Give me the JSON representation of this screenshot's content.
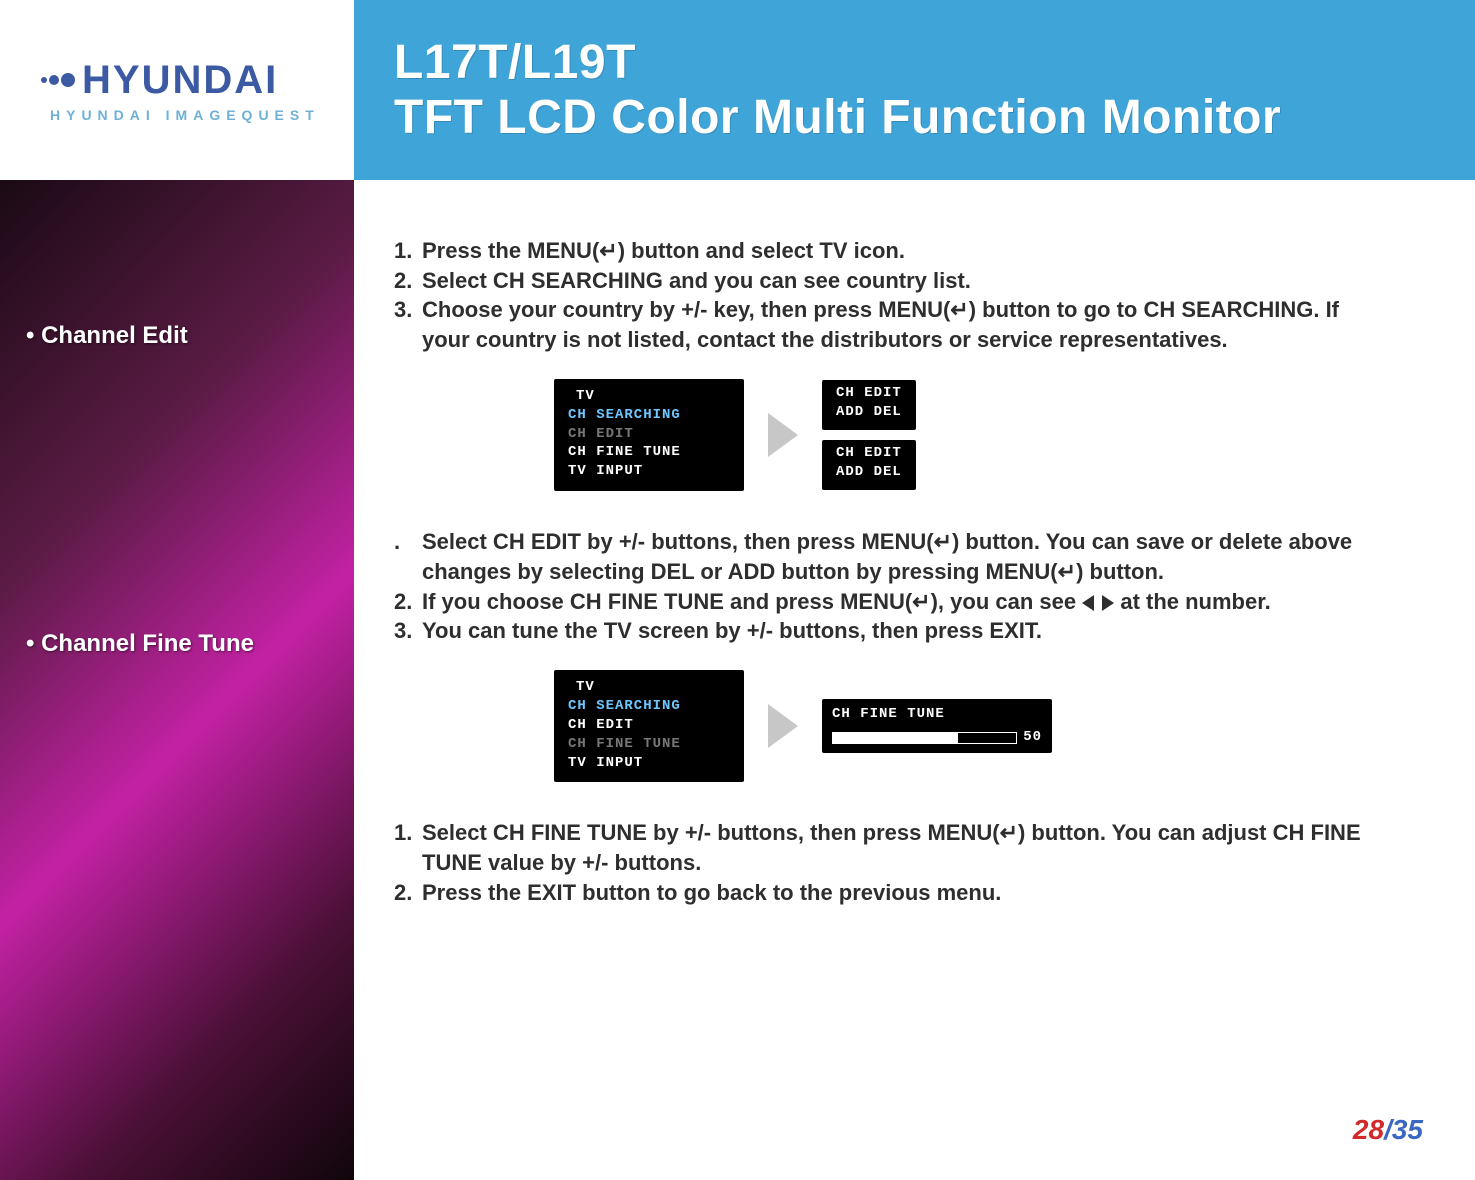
{
  "logo": {
    "brand": "HYUNDAI",
    "subtitle": "HYUNDAI  IMAGEQUEST"
  },
  "title": {
    "line1": "L17T/L19T",
    "line2": "TFT LCD Color Multi Function Monitor"
  },
  "sidebar": {
    "item_edit": "• Channel Edit",
    "item_fine": "• Channel Fine Tune"
  },
  "section1": {
    "steps": [
      {
        "n": "1.",
        "t": "Press the MENU(↵) button and select TV icon."
      },
      {
        "n": "2.",
        "t": "Select CH SEARCHING and you can see country list."
      },
      {
        "n": "3.",
        "t": "Choose your country by +/- key, then press MENU(↵) button to go to CH SEARCHING. If your country is not listed, contact the distributors or service representatives."
      }
    ]
  },
  "osd1": {
    "menu_title": "TV",
    "items": [
      {
        "label": "CH  SEARCHING",
        "state": "hi"
      },
      {
        "label": "CH  EDIT",
        "state": "dim"
      },
      {
        "label": "CH  FINE  TUNE",
        "state": "normal"
      },
      {
        "label": "TV  INPUT",
        "state": "normal"
      }
    ],
    "edit_panels": [
      {
        "title": "CH  EDIT",
        "left": "ADD",
        "left_state": "dim",
        "right": "DEL",
        "right_state": "normal"
      },
      {
        "title": "CH  EDIT",
        "left": "ADD",
        "left_state": "normal",
        "right": "DEL",
        "right_state": "dim"
      }
    ]
  },
  "section2": {
    "steps": [
      {
        "n": ".",
        "t": "Select CH EDIT by +/- buttons, then press MENU(↵) button. You can save or delete above changes by selecting DEL or ADD button by pressing MENU(↵) button."
      },
      {
        "n": "2.",
        "t_before": "If you choose CH FINE TUNE and press MENU(↵), you can see  ",
        "t_after": "  at the number."
      },
      {
        "n": "3.",
        "t": "You can tune the TV screen by +/- buttons, then press EXIT."
      }
    ]
  },
  "osd2": {
    "menu_title": "TV",
    "items": [
      {
        "label": "CH  SEARCHING",
        "state": "hi"
      },
      {
        "label": "CH  EDIT",
        "state": "normal"
      },
      {
        "label": "CH  FINE  TUNE",
        "state": "dim"
      },
      {
        "label": "TV  INPUT",
        "state": "normal"
      }
    ],
    "tune": {
      "title": "CH  FINE  TUNE",
      "value": "50",
      "percent": 68
    }
  },
  "section3": {
    "steps": [
      {
        "n": "1.",
        "t": "Select CH FINE TUNE by +/- buttons, then press MENU(↵) button. You can adjust CH FINE TUNE value by +/- buttons."
      },
      {
        "n": "2.",
        "t": "Press the EXIT button to go back to the previous menu."
      }
    ]
  },
  "page": {
    "current": "28",
    "sep": "/",
    "total": "35"
  }
}
